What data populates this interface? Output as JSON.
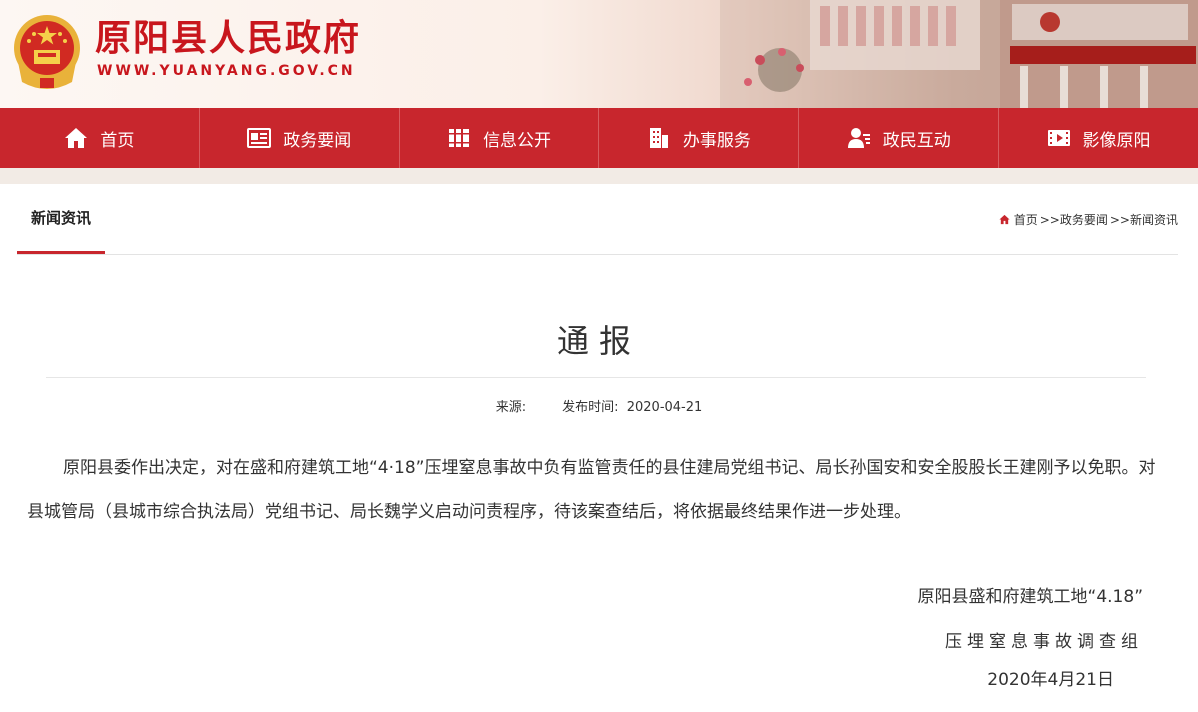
{
  "header": {
    "site_title": "原阳县人民政府",
    "site_url": "WWW.YUANYANG.GOV.CN"
  },
  "nav": [
    {
      "label": "首页",
      "icon": "home-icon"
    },
    {
      "label": "政务要闻",
      "icon": "newspaper-icon"
    },
    {
      "label": "信息公开",
      "icon": "books-icon"
    },
    {
      "label": "办事服务",
      "icon": "building-icon"
    },
    {
      "label": "政民互动",
      "icon": "user-chat-icon"
    },
    {
      "label": "影像原阳",
      "icon": "film-icon"
    }
  ],
  "section": {
    "tab_label": "新闻资讯",
    "breadcrumb": [
      "首页",
      ">>政务要闻",
      ">>新闻资讯"
    ]
  },
  "article": {
    "title": "通报",
    "source_label": "来源:",
    "publish_label": "发布时间:",
    "publish_date": "2020-04-21",
    "paragraph": "原阳县委作出决定，对在盛和府建筑工地“4·18”压埋窒息事故中负有监管责任的县住建局党组书记、局长孙国安和安全股股长王建刚予以免职。对县城管局（县城市综合执法局）党组书记、局长魏学义启动问责程序，待该案查结后，将依据最终结果作进一步处理。",
    "sign_line1": "原阳县盛和府建筑工地“4.18”",
    "sign_line2": "压埋窒息事故调查组",
    "sign_date": "2020年4月21日"
  },
  "colors": {
    "brand_red": "#c8262d",
    "title_red": "#c8161d"
  }
}
